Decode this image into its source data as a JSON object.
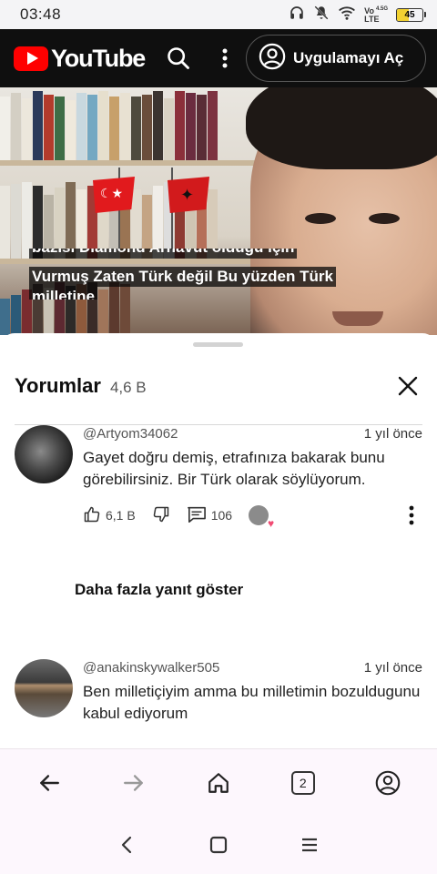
{
  "status_bar": {
    "time": "03:48",
    "network_top": "Vo",
    "network_bottom": "LTE",
    "network_gen": "4.5G",
    "battery": "45",
    "battery_fraction": 0.45
  },
  "header": {
    "logo_text": "YouTube",
    "open_app_label": "Uygulamayı Aç"
  },
  "video": {
    "caption_partial": "bazısı Diamond Arnavut olduğu için",
    "caption_line1": "Vurmuş Zaten Türk değil Bu yüzden Türk",
    "caption_line2": "milletine"
  },
  "comments_panel": {
    "title": "Yorumlar",
    "count": "4,6 B",
    "comments": [
      {
        "author": "@Artyom34062",
        "time": "1 yıl önce",
        "text": "Gayet doğru demiş, etrafınıza bakarak bunu görebilirsiniz. Bir Türk olarak söylüyorum.",
        "likes": "6,1 B",
        "replies": "106"
      },
      {
        "author": "@anakinskywalker505",
        "time": "1 yıl önce",
        "text": "Ben milletiçiyim amma bu milletimin bozuldugunu kabul ediyorum"
      }
    ],
    "more_replies_label": "Daha fazla yanıt göster"
  },
  "browser_bar": {
    "tab_count": "2"
  },
  "colors": {
    "youtube_red": "#ff0000",
    "header_bg": "#0f0f0f",
    "heart": "#f14b73",
    "battery_fill": "#f2d232"
  },
  "icons": [
    "headphones-icon",
    "mute-icon",
    "wifi-icon",
    "battery-icon",
    "search-icon",
    "more-vert-icon",
    "account-icon",
    "close-icon",
    "like-icon",
    "dislike-icon",
    "reply-icon",
    "back-arrow-icon",
    "forward-arrow-icon",
    "home-icon",
    "tabs-icon",
    "profile-icon"
  ]
}
